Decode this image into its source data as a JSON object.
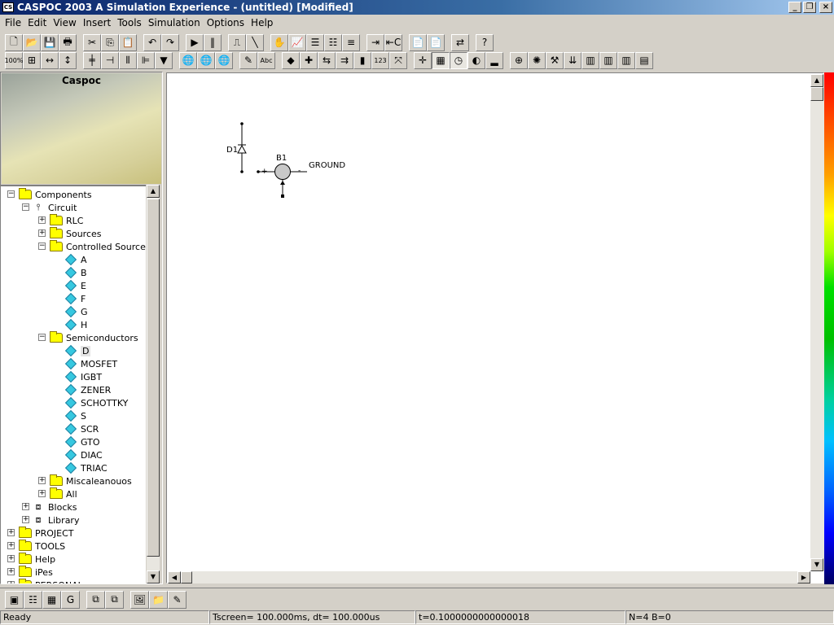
{
  "window": {
    "title": "CASPOC 2003 A Simulation Experience - (untitled) [Modified]",
    "icon_label": "CS"
  },
  "menu": [
    "File",
    "Edit",
    "View",
    "Insert",
    "Tools",
    "Simulation",
    "Options",
    "Help"
  ],
  "toolbar1": [
    "new-icon",
    "open-icon",
    "save-icon",
    "print-icon",
    "sep",
    "cut-icon",
    "copy-icon",
    "paste-icon",
    "sep",
    "undo-icon",
    "redo-icon",
    "sep",
    "run-icon",
    "pause-icon",
    "sep",
    "scope-icon",
    "waveform-icon",
    "sep",
    "hand-icon",
    "graph-icon",
    "list-icon",
    "list2-icon",
    "settings-icon",
    "sep",
    "arrow-right-icon",
    "arrow-c-icon",
    "sep",
    "doc-icon",
    "doc2-icon",
    "sep",
    "link-icon",
    "sep",
    "help-icon"
  ],
  "toolbar1_glyphs": [
    "🗋",
    "📂",
    "💾",
    "🖶",
    "",
    "✂",
    "⎘",
    "📋",
    "",
    "↶",
    "↷",
    "",
    "▶",
    "‖",
    "",
    "⎍",
    "╲",
    "",
    "✋",
    "📈",
    "☰",
    "☷",
    "≡",
    "",
    "⇥",
    "⇤C",
    "",
    "📄",
    "📄",
    "",
    "⇄",
    "",
    "?"
  ],
  "toolbar2": [
    "zoom100-icon",
    "zoomfit-icon",
    "hresize-icon",
    "vresize-icon",
    "sep",
    "node-icon",
    "resistor-icon",
    "switch-icon",
    "capacitor-icon",
    "probe-icon",
    "sep",
    "globe-icon",
    "globe2-icon",
    "globe3-icon",
    "sep",
    "pencil-icon",
    "text-icon",
    "sep",
    "color-icon",
    "cross-icon",
    "flip-icon",
    "mirror-icon",
    "block-icon",
    "counter-icon",
    "wire-icon",
    "sep",
    "junction-icon",
    "grid-icon",
    "clock-icon",
    "fill-icon",
    "bars-icon",
    "sep",
    "fit-icon",
    "rotate-icon",
    "tools-icon",
    "sort-icon",
    "chip-icon",
    "chip2-icon",
    "chip3-icon",
    "table-icon"
  ],
  "toolbar2_glyphs": [
    "100%",
    "⊞",
    "↔",
    "↕",
    "",
    "╪",
    "⊣",
    "⫴",
    "⊫",
    "▼",
    "",
    "🌐",
    "🌐",
    "🌐",
    "",
    "✎",
    "Abc",
    "",
    "◆",
    "✚",
    "⇆",
    "⇉",
    "▮",
    "123",
    "⤧",
    "",
    "✛",
    "▦",
    "◷",
    "◐",
    "▂",
    "",
    "⊕",
    "✺",
    "⚒",
    "⇊",
    "▥",
    "▥",
    "▥",
    "▤"
  ],
  "toolbar2_pressed": [
    "grid-icon",
    "clock-icon"
  ],
  "logo_text": "Caspoc",
  "tree": [
    {
      "label": "Components",
      "depth": 0,
      "exp": "−",
      "icon": "folder"
    },
    {
      "label": "Circuit",
      "depth": 1,
      "exp": "−",
      "icon": "circuit"
    },
    {
      "label": "RLC",
      "depth": 2,
      "exp": "+",
      "icon": "folder"
    },
    {
      "label": "Sources",
      "depth": 2,
      "exp": "+",
      "icon": "folder"
    },
    {
      "label": "Controlled Sources",
      "depth": 2,
      "exp": "−",
      "icon": "folder"
    },
    {
      "label": "A",
      "depth": 3,
      "exp": "",
      "icon": "diamond"
    },
    {
      "label": "B",
      "depth": 3,
      "exp": "",
      "icon": "diamond"
    },
    {
      "label": "E",
      "depth": 3,
      "exp": "",
      "icon": "diamond"
    },
    {
      "label": "F",
      "depth": 3,
      "exp": "",
      "icon": "diamond"
    },
    {
      "label": "G",
      "depth": 3,
      "exp": "",
      "icon": "diamond"
    },
    {
      "label": "H",
      "depth": 3,
      "exp": "",
      "icon": "diamond"
    },
    {
      "label": "Semiconductors",
      "depth": 2,
      "exp": "−",
      "icon": "folder"
    },
    {
      "label": "D",
      "depth": 3,
      "exp": "",
      "icon": "diamond",
      "selected": true
    },
    {
      "label": "MOSFET",
      "depth": 3,
      "exp": "",
      "icon": "diamond"
    },
    {
      "label": "IGBT",
      "depth": 3,
      "exp": "",
      "icon": "diamond"
    },
    {
      "label": "ZENER",
      "depth": 3,
      "exp": "",
      "icon": "diamond"
    },
    {
      "label": "SCHOTTKY",
      "depth": 3,
      "exp": "",
      "icon": "diamond"
    },
    {
      "label": "S",
      "depth": 3,
      "exp": "",
      "icon": "diamond"
    },
    {
      "label": "SCR",
      "depth": 3,
      "exp": "",
      "icon": "diamond"
    },
    {
      "label": "GTO",
      "depth": 3,
      "exp": "",
      "icon": "diamond"
    },
    {
      "label": "DIAC",
      "depth": 3,
      "exp": "",
      "icon": "diamond"
    },
    {
      "label": "TRIAC",
      "depth": 3,
      "exp": "",
      "icon": "diamond"
    },
    {
      "label": "Miscaleanouos",
      "depth": 2,
      "exp": "+",
      "icon": "folder"
    },
    {
      "label": "All",
      "depth": 2,
      "exp": "+",
      "icon": "folder"
    },
    {
      "label": "Blocks",
      "depth": 1,
      "exp": "+",
      "icon": "blocks"
    },
    {
      "label": "Library",
      "depth": 1,
      "exp": "+",
      "icon": "blocks"
    },
    {
      "label": "PROJECT",
      "depth": 0,
      "exp": "+",
      "icon": "folder"
    },
    {
      "label": "TOOLS",
      "depth": 0,
      "exp": "+",
      "icon": "folder"
    },
    {
      "label": "Help",
      "depth": 0,
      "exp": "+",
      "icon": "folder"
    },
    {
      "label": "iPes",
      "depth": 0,
      "exp": "+",
      "icon": "folder"
    },
    {
      "label": "PERSONAL",
      "depth": 0,
      "exp": "+",
      "icon": "folder"
    }
  ],
  "schematic": {
    "diode_label": "D1",
    "block_label": "B1",
    "plus": "+",
    "minus": "-",
    "ground_label": "GROUND"
  },
  "bottom_toolbar": [
    "module-icon",
    "schematic-icon",
    "chip-icon",
    "refresh-icon",
    "sep",
    "window-icon",
    "window2-icon",
    "sep",
    "image-icon",
    "folder-icon",
    "edit-icon"
  ],
  "bottom_glyphs": [
    "▣",
    "☷",
    "▦",
    "G",
    "",
    "⧉",
    "⧉",
    "",
    "🖼",
    "📁",
    "✎"
  ],
  "status": {
    "ready": "Ready",
    "tscreen": "Tscreen= 100.000ms, dt= 100.000us",
    "time": "t=0.1000000000000018",
    "counts": "N=4 B=0"
  }
}
